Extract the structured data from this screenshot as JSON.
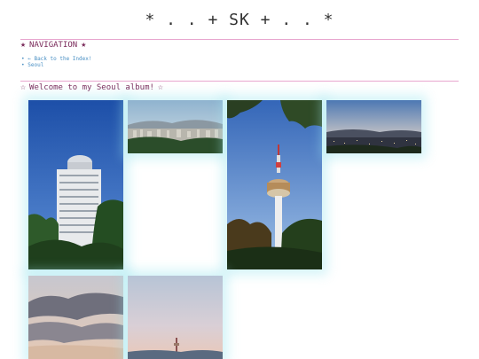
{
  "site": {
    "title": "* . . + SK + . . *"
  },
  "navigation": {
    "heading": "NAVIGATION",
    "links": [
      {
        "label": "← Back to the Index!"
      },
      {
        "label": "Seoul"
      }
    ]
  },
  "album": {
    "heading": "Welcome to my Seoul album!",
    "photos": [
      {
        "id": "tower-building"
      },
      {
        "id": "city-panorama"
      },
      {
        "id": "namsan-tower"
      },
      {
        "id": "city-sunset"
      },
      {
        "id": "cloudy-sky"
      },
      {
        "id": "dusk-tower-far"
      }
    ]
  },
  "colors": {
    "accent_line": "#e8a6cf",
    "heading_text": "#7a2a5a",
    "link": "#4a90c4",
    "glow": "#a0e6f0"
  }
}
